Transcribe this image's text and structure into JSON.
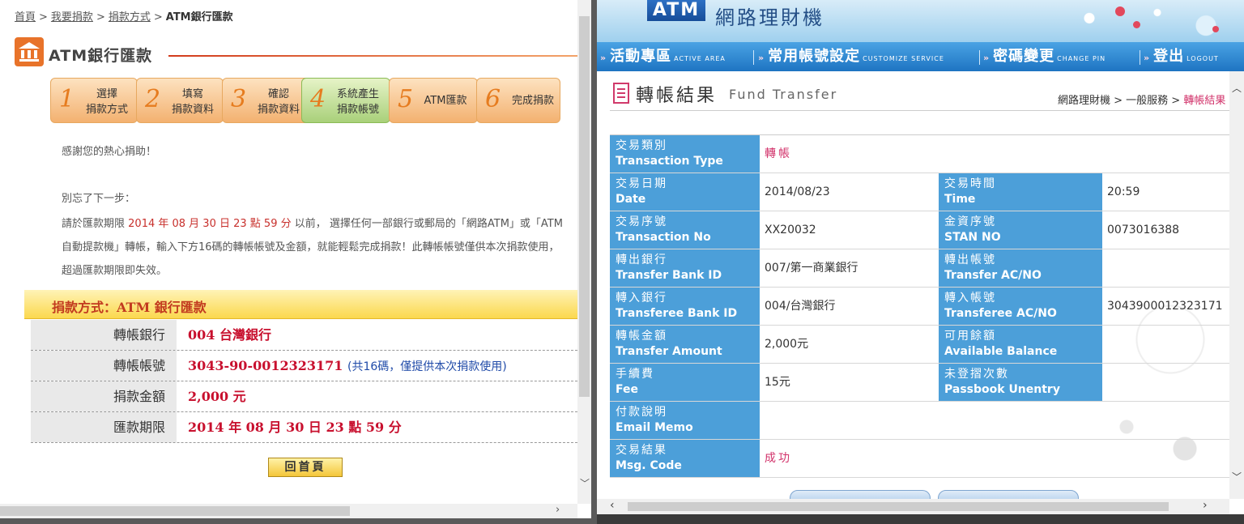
{
  "left": {
    "breadcrumb": [
      {
        "label": "首頁"
      },
      {
        "label": "我要捐款"
      },
      {
        "label": "捐款方式"
      }
    ],
    "breadcrumb_sep": ">",
    "breadcrumb_current": "ATM銀行匯款",
    "page_title": "ATM銀行匯款",
    "steps": [
      {
        "num": "1",
        "line1": "選擇",
        "line2": "捐款方式"
      },
      {
        "num": "2",
        "line1": "填寫",
        "line2": "捐款資料"
      },
      {
        "num": "3",
        "line1": "確認",
        "line2": "捐款資料"
      },
      {
        "num": "4",
        "line1": "系統產生",
        "line2": "捐款帳號"
      },
      {
        "num": "5",
        "line1": "ATM匯款",
        "line2": ""
      },
      {
        "num": "6",
        "line1": "完成捐款",
        "line2": ""
      }
    ],
    "active_step": 4,
    "thanks": "感謝您的熱心捐助！",
    "reminder": "別忘了下一步：",
    "body_pre": "請於匯款期限",
    "body_deadline": "2014 年 08 月 30 日 23 點 59 分",
    "body_post": "以前， 選擇任何一部銀行或郵局的「網路ATM」或「ATM自動提款機」轉帳，輸入下方16碼的轉帳帳號及金額，就能輕鬆完成捐款！此轉帳帳號僅供本次捐款使用，超過匯款期限即失效。",
    "method_bar": "捐款方式：ATM 銀行匯款",
    "rows": [
      {
        "label": "轉帳銀行",
        "value": "004 台灣銀行",
        "note": ""
      },
      {
        "label": "轉帳帳號",
        "value": "3043-90-0012323171",
        "note": "(共16碼，僅提供本次捐款使用)"
      },
      {
        "label": "捐款金額",
        "value": "2,000 元",
        "note": ""
      },
      {
        "label": "匯款期限",
        "value": "2014 年 08 月 30 日 23 點 59 分",
        "note": ""
      }
    ],
    "home_button": "回首頁"
  },
  "right": {
    "logo": "ATM",
    "app_title": "網路理財機",
    "nav": [
      {
        "label": "活動專區",
        "en": "ACTIVE AREA"
      },
      {
        "label": "常用帳號設定",
        "en": "CUSTOMIZE SERVICE"
      },
      {
        "label": "密碼變更",
        "en": "CHANGE PIN"
      },
      {
        "label": "登出",
        "en": "LOGOUT"
      }
    ],
    "page_title_zh": "轉帳結果",
    "page_title_en": "Fund Transfer",
    "breadcrumb": "網路理財機 > 一般服務 >",
    "breadcrumb_current": "轉帳結果",
    "rows": [
      {
        "k1z": "交易類別",
        "k1e": "Transaction Type",
        "v1": "轉帳",
        "full": true,
        "pink": true
      },
      {
        "k1z": "交易日期",
        "k1e": "Date",
        "v1": "2014/08/23",
        "k2z": "交易時間",
        "k2e": "Time",
        "v2": "20:59"
      },
      {
        "k1z": "交易序號",
        "k1e": "Transaction No",
        "v1": "XX20032",
        "k2z": "金資序號",
        "k2e": "STAN NO",
        "v2": "0073016388"
      },
      {
        "k1z": "轉出銀行",
        "k1e": "Transfer Bank ID",
        "v1": "007/第一商業銀行",
        "k2z": "轉出帳號",
        "k2e": "Transfer AC/NO",
        "v2": ""
      },
      {
        "k1z": "轉入銀行",
        "k1e": "Transferee Bank ID",
        "v1": "004/台灣銀行",
        "k2z": "轉入帳號",
        "k2e": "Transferee AC/NO",
        "v2": "3043900012323171"
      },
      {
        "k1z": "轉帳金額",
        "k1e": "Transfer Amount",
        "v1": "2,000元",
        "k2z": "可用餘額",
        "k2e": "Available Balance",
        "v2": ""
      },
      {
        "k1z": "手續費",
        "k1e": "Fee",
        "v1": "15元",
        "k2z": "未登摺次數",
        "k2e": "Passbook Unentry",
        "v2": ""
      },
      {
        "k1z": "付款說明",
        "k1e": "Email Memo",
        "v1": "",
        "full": true
      },
      {
        "k1z": "交易結果",
        "k1e": "Msg. Code",
        "v1": "成功",
        "full": true,
        "pink": true
      }
    ]
  },
  "colors": {
    "accent_orange": "#e8732a",
    "deadline_red": "#c8302c",
    "table_key_blue": "#4c9fd9",
    "nav_blue": "#1e74c2",
    "pink_value": "#d2336b"
  }
}
